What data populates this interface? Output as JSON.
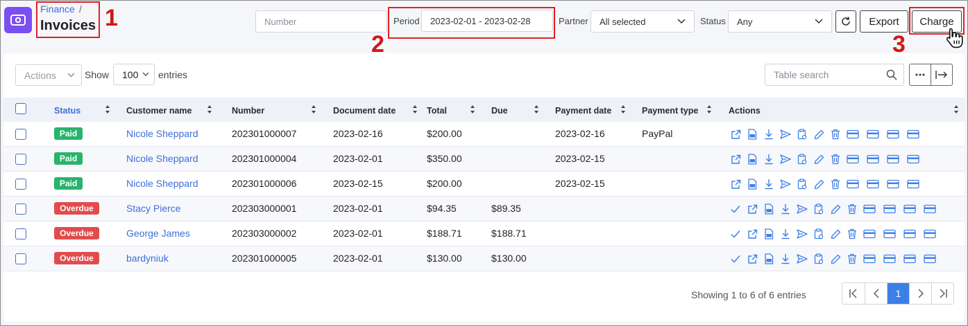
{
  "breadcrumb": {
    "parent": "Finance",
    "separator": "/",
    "title": "Invoices"
  },
  "callouts": [
    "1",
    "2",
    "3"
  ],
  "filters": {
    "number_placeholder": "Number",
    "period_label": "Period",
    "period_value": "2023-02-01 - 2023-02-28",
    "partner_label": "Partner",
    "partner_value": "All selected",
    "status_label": "Status",
    "status_value": "Any"
  },
  "toolbar": {
    "export_label": "Export",
    "charge_label": "Charge"
  },
  "table_controls": {
    "actions_label": "Actions",
    "show_label": "Show",
    "entries_value": "100",
    "entries_label": "entries",
    "search_placeholder": "Table search"
  },
  "columns": [
    "Status",
    "Customer name",
    "Number",
    "Document date",
    "Total",
    "Due",
    "Payment date",
    "Payment type",
    "Actions"
  ],
  "rows": [
    {
      "status": "Paid",
      "status_kind": "paid",
      "customer": "Nicole Sheppard",
      "number": "202301000007",
      "doc_date": "2023-02-16",
      "total": "$200.00",
      "due": "",
      "pay_date": "2023-02-16",
      "pay_type": "PayPal",
      "actions": [
        "external-link-icon",
        "pdf-icon",
        "download-icon",
        "send-icon",
        "clipboard-icon",
        "edit-icon",
        "trash-icon",
        "card-icon",
        "card-icon",
        "card-icon",
        "card-icon"
      ]
    },
    {
      "status": "Paid",
      "status_kind": "paid",
      "customer": "Nicole Sheppard",
      "number": "202301000004",
      "doc_date": "2023-02-01",
      "total": "$350.00",
      "due": "",
      "pay_date": "2023-02-15",
      "pay_type": "",
      "actions": [
        "external-link-icon",
        "pdf-icon",
        "download-icon",
        "send-icon",
        "clipboard-icon",
        "edit-icon",
        "trash-icon",
        "card-icon",
        "card-icon",
        "card-icon",
        "card-icon"
      ]
    },
    {
      "status": "Paid",
      "status_kind": "paid",
      "customer": "Nicole Sheppard",
      "number": "202301000006",
      "doc_date": "2023-02-15",
      "total": "$200.00",
      "due": "",
      "pay_date": "2023-02-15",
      "pay_type": "",
      "actions": [
        "external-link-icon",
        "pdf-icon",
        "download-icon",
        "send-icon",
        "clipboard-icon",
        "edit-icon",
        "trash-icon",
        "card-icon",
        "card-icon",
        "card-icon",
        "card-icon"
      ]
    },
    {
      "status": "Overdue",
      "status_kind": "overdue",
      "customer": "Stacy Pierce",
      "number": "202303000001",
      "doc_date": "2023-02-01",
      "total": "$94.35",
      "due": "$89.35",
      "pay_date": "",
      "pay_type": "",
      "actions": [
        "check-icon",
        "external-link-icon",
        "pdf-icon",
        "download-icon",
        "send-icon",
        "clipboard-icon",
        "edit-icon",
        "trash-icon",
        "card-icon",
        "card-icon",
        "card-icon",
        "card-icon"
      ]
    },
    {
      "status": "Overdue",
      "status_kind": "overdue",
      "customer": "George James",
      "number": "202303000002",
      "doc_date": "2023-02-01",
      "total": "$188.71",
      "due": "$188.71",
      "pay_date": "",
      "pay_type": "",
      "actions": [
        "check-icon",
        "external-link-icon",
        "pdf-icon",
        "download-icon",
        "send-icon",
        "clipboard-icon",
        "edit-icon",
        "trash-icon",
        "card-icon",
        "card-icon",
        "card-icon",
        "card-icon"
      ]
    },
    {
      "status": "Overdue",
      "status_kind": "overdue",
      "customer": "bardyniuk",
      "number": "202301000005",
      "doc_date": "2023-02-01",
      "total": "$130.00",
      "due": "$130.00",
      "pay_date": "",
      "pay_type": "",
      "actions": [
        "check-icon",
        "external-link-icon",
        "pdf-icon",
        "download-icon",
        "send-icon",
        "clipboard-icon",
        "edit-icon",
        "trash-icon",
        "card-icon",
        "card-icon",
        "card-icon",
        "card-icon"
      ]
    }
  ],
  "pagination": {
    "showing_text": "Showing 1 to 6 of 6 entries",
    "current_page": "1"
  },
  "colors": {
    "accent": "#3d6fd8",
    "paid": "#29b36b",
    "overdue": "#e24b4b",
    "highlight": "#e02020",
    "app_icon": "#7b4ef2"
  }
}
